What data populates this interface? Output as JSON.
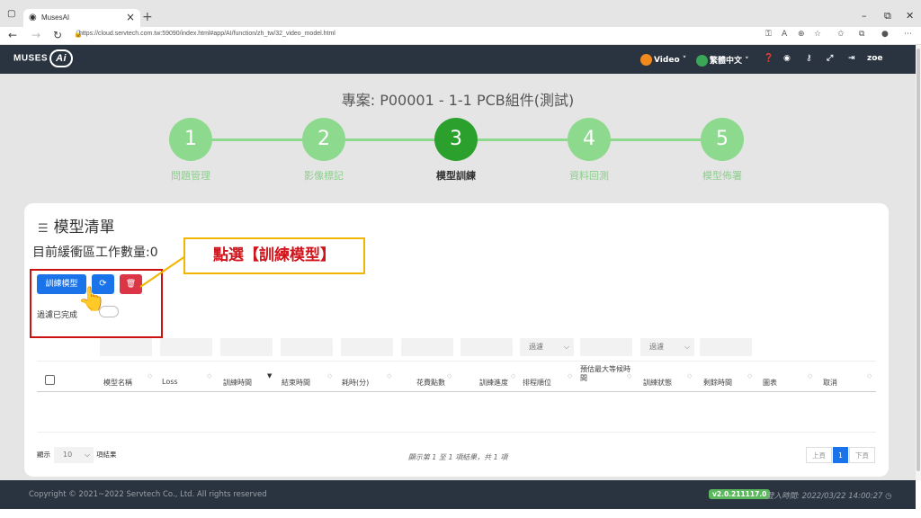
{
  "browser": {
    "tab_title": "MusesAI",
    "tab_close": "×",
    "new_tab": "+",
    "url": "https://cloud.servtech.com.tw:59090/index.html#app/AI/function/zh_tw/32_video_model.html",
    "win_min": "–",
    "win_restore": "⧉",
    "win_close": "✕"
  },
  "header": {
    "logo_text": "MUSES",
    "logo_ai": "Ai",
    "video_label": "Video",
    "lang_label": "繁體中文",
    "user": "zoe"
  },
  "project": {
    "title": "專案: P00001 - 1-1 PCB組件(測試)"
  },
  "steps": [
    {
      "num": "1",
      "label": "問題管理"
    },
    {
      "num": "2",
      "label": "影像標記"
    },
    {
      "num": "3",
      "label": "模型訓練"
    },
    {
      "num": "4",
      "label": "資料回測"
    },
    {
      "num": "5",
      "label": "模型佈署"
    }
  ],
  "active_step": 3,
  "card": {
    "title": "模型清單",
    "queue_label": "目前緩衝區工作數量:0",
    "train_button": "訓練模型",
    "filter_done": "過濾已完成",
    "callout": "點選【訓練模型】"
  },
  "filters": {
    "select1": "過濾",
    "select2": "過濾"
  },
  "table": {
    "columns": [
      "模型名稱",
      "Loss",
      "訓練時間",
      "結束時間",
      "耗時(分)",
      "花費點數",
      "訓練進度",
      "排程順位",
      "預估最大等候時間",
      "訓練狀態",
      "剩餘時間",
      "圖表",
      "取消"
    ]
  },
  "pagination": {
    "show": "顯示",
    "page_size": "10",
    "items": "項結果",
    "summary": "顯示第 1 至 1 項結果，共 1 項",
    "prev": "上頁",
    "current": "1",
    "next": "下頁"
  },
  "footer": {
    "copyright": "Copyright © 2021~2022 Servtech Co., Ltd. All rights reserved",
    "version": "v2.0.211117.0",
    "login_label": "登入時間:",
    "login_time": "2022/03/22 14:00:27"
  },
  "colors": {
    "header_bg": "#2a3441",
    "step_done": "#8dd98d",
    "step_active": "#2ca02c",
    "primary": "#1a73e8",
    "danger": "#dc3545",
    "callout_border": "#f2b600",
    "callout_text": "#d0141b"
  }
}
